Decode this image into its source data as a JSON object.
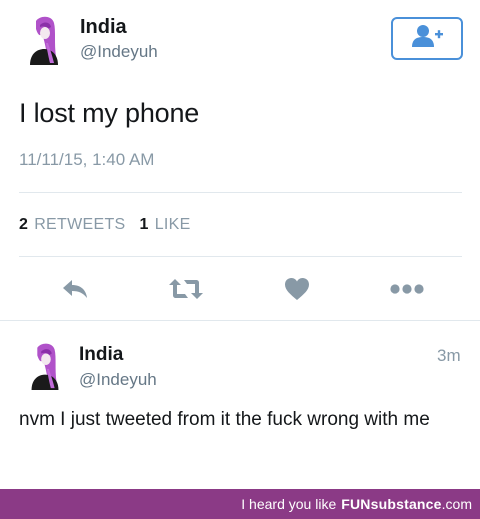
{
  "tweet": {
    "author_name": "India",
    "author_handle": "@Indeyuh",
    "text": "I lost my phone",
    "timestamp": "11/11/15, 1:40 AM",
    "retweets_count": "2",
    "retweets_label": "RETWEETS",
    "likes_count": "1",
    "likes_label": "LIKE"
  },
  "reply": {
    "author_name": "India",
    "author_handle": "@Indeyuh",
    "time_ago": "3m",
    "text": "nvm I just tweeted from it the fuck wrong with me"
  },
  "footer": {
    "prefix": "I heard you like",
    "brand": "FUNsubstance",
    "suffix": ".com"
  },
  "colors": {
    "accent_blue": "#4a90d9",
    "icon_grey": "#8899a6",
    "footer_bg": "#8b3a86",
    "avatar_hair": "#b052c9"
  },
  "icons": {
    "follow": "follow-user-icon",
    "reply": "reply-icon",
    "retweet": "retweet-icon",
    "like": "heart-icon",
    "more": "more-dots-icon"
  }
}
